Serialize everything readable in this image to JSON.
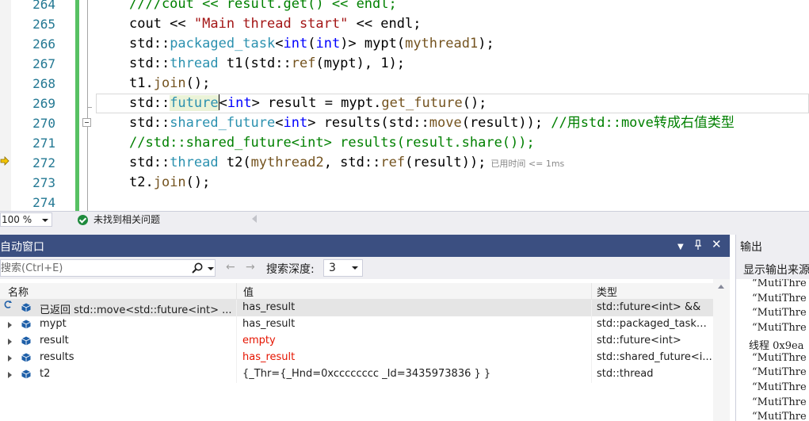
{
  "editor": {
    "line_numbers": [
      "264",
      "265",
      "266",
      "267",
      "268",
      "269",
      "270",
      "271",
      "272",
      "273",
      "274"
    ],
    "lines": [
      {
        "tokens": [
          {
            "t": "////cout << result.get() << endl;",
            "c": "cm"
          }
        ]
      },
      {
        "tokens": [
          {
            "t": "cout << "
          },
          {
            "t": "\"Main thread start\"",
            "c": "str"
          },
          {
            "t": " << endl;"
          }
        ]
      },
      {
        "tokens": [
          {
            "t": "std::"
          },
          {
            "t": "packaged_task",
            "c": "ty"
          },
          {
            "t": "<"
          },
          {
            "t": "int",
            "c": "kw"
          },
          {
            "t": "("
          },
          {
            "t": "int",
            "c": "kw"
          },
          {
            "t": ")> mypt("
          },
          {
            "t": "mythread1",
            "c": "fn"
          },
          {
            "t": ");"
          }
        ]
      },
      {
        "tokens": [
          {
            "t": "std::"
          },
          {
            "t": "thread",
            "c": "ty"
          },
          {
            "t": " t1(std::"
          },
          {
            "t": "ref",
            "c": "fn"
          },
          {
            "t": "(mypt), 1);"
          }
        ]
      },
      {
        "tokens": [
          {
            "t": "t1."
          },
          {
            "t": "join",
            "c": "fn"
          },
          {
            "t": "();"
          }
        ]
      },
      {
        "tokens": [
          {
            "t": "std::"
          },
          {
            "t": "future",
            "c": "ty hl"
          },
          {
            "t": "|",
            "c": "cursor"
          },
          {
            "t": "<"
          },
          {
            "t": "int",
            "c": "kw"
          },
          {
            "t": "> result = mypt."
          },
          {
            "t": "get_future",
            "c": "fn"
          },
          {
            "t": "();"
          }
        ]
      },
      {
        "tokens": [
          {
            "t": "std::"
          },
          {
            "t": "shared_future",
            "c": "ty"
          },
          {
            "t": "<"
          },
          {
            "t": "int",
            "c": "kw"
          },
          {
            "t": "> results(std::"
          },
          {
            "t": "move",
            "c": "fn"
          },
          {
            "t": "(result)); "
          },
          {
            "t": "//用std::move转成右值类型",
            "c": "cm"
          }
        ]
      },
      {
        "tokens": [
          {
            "t": "//std::shared_future<int> results(result.share());",
            "c": "cm"
          }
        ]
      },
      {
        "tokens": [
          {
            "t": "std::"
          },
          {
            "t": "thread",
            "c": "ty"
          },
          {
            "t": " t2("
          },
          {
            "t": "mythread2",
            "c": "fn"
          },
          {
            "t": ", std::"
          },
          {
            "t": "ref",
            "c": "fn"
          },
          {
            "t": "(result));"
          }
        ],
        "elapsed": "已用时间 <= 1ms"
      },
      {
        "tokens": [
          {
            "t": "t2."
          },
          {
            "t": "join",
            "c": "fn"
          },
          {
            "t": "();"
          }
        ]
      },
      {
        "tokens": []
      }
    ]
  },
  "status": {
    "zoom": "100 %",
    "issues": "未找到相关问题"
  },
  "autos": {
    "title": "自动窗口",
    "search_placeholder": "搜索(Ctrl+E)",
    "depth_label": "搜索深度:",
    "depth_value": "3",
    "columns": {
      "name": "名称",
      "value": "值",
      "type": "类型"
    },
    "rows": [
      {
        "name": "已返回 std::move<std::future<int> ...",
        "value": "has_result",
        "type": "std::future<int> &&",
        "red": false
      },
      {
        "name": "mypt",
        "value": "has_result",
        "type": "std::packaged_task<...",
        "red": false
      },
      {
        "name": "result",
        "value": "empty",
        "type": "std::future<int>",
        "red": true
      },
      {
        "name": "results",
        "value": "has_result",
        "type": "std::shared_future<i...",
        "red": true
      },
      {
        "name": "t2",
        "value": "{_Thr={_Hnd=0xcccccccc _Id=3435973836 } }",
        "type": "std::thread",
        "red": false
      }
    ]
  },
  "output": {
    "title": "输出",
    "source_label": "显示输出来源",
    "lines": [
      "“MutiThre",
      "“MutiThre",
      "“MutiThre",
      "“MutiThre",
      "线程 0x9ea",
      "“MutiThre",
      "“MutiThre",
      "“MutiThre",
      "“MutiThre",
      "“MutiThre"
    ]
  },
  "colors": {
    "title_bar": "#3b4f81",
    "change_bar": "#57c163",
    "line_number": "#237893",
    "keyword": "#0000ff",
    "type": "#2b91af",
    "string": "#a31515",
    "comment": "#008000",
    "error_value": "#e51400"
  }
}
